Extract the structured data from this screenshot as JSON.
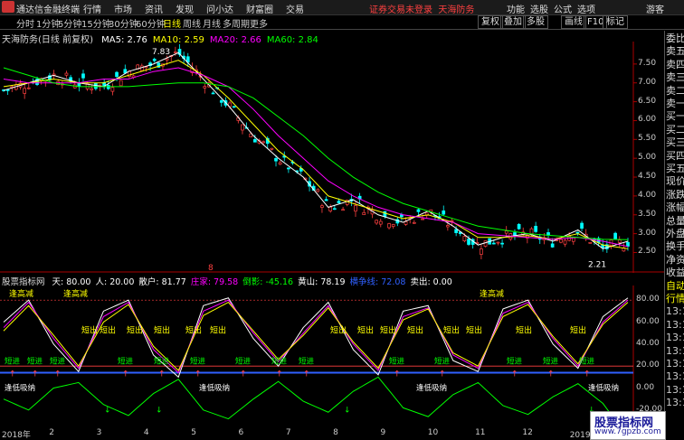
{
  "app": {
    "name": "通达信金融终端",
    "menu": [
      "行情",
      "市场",
      "资讯",
      "发现",
      "问小达",
      "财富圈",
      "交易"
    ],
    "ad_text": "证券交易未登录",
    "ad_link": "天海防务",
    "right_menu": [
      "功能",
      "选股",
      "公式",
      "选项"
    ],
    "user": "游客"
  },
  "toolbar": {
    "periods": [
      "分时",
      "1分钟",
      "5分钟",
      "15分钟",
      "30分钟",
      "60分钟",
      "日线",
      "周线",
      "月线",
      "多周期",
      "更多"
    ],
    "active_period": "日线",
    "right_buttons": [
      "复权",
      "叠加",
      "多股",
      "画线",
      "F10",
      "标记"
    ]
  },
  "chart_header": {
    "stock": "天海防务",
    "period_note": "(日线 前复权)",
    "ma": [
      {
        "label": "MA5:",
        "value": "2.76",
        "color": "#ffffff"
      },
      {
        "label": "MA10:",
        "value": "2.59",
        "color": "#ffff00"
      },
      {
        "label": "MA20:",
        "value": "2.66",
        "color": "#ff00ff"
      },
      {
        "label": "MA60:",
        "value": "2.84",
        "color": "#00ff00"
      }
    ]
  },
  "indicator_header": {
    "name": "股票指标网",
    "fields": [
      {
        "label": "天:",
        "value": "80.00",
        "color": "#ffffff"
      },
      {
        "label": "人:",
        "value": "20.00",
        "color": "#ffffff"
      },
      {
        "label": "散户:",
        "value": "81.77",
        "color": "#ffffff"
      },
      {
        "label": "庄家:",
        "value": "79.58",
        "color": "#ff00ff"
      },
      {
        "label": "倒影:",
        "value": "-45.16",
        "color": "#00ff00"
      },
      {
        "label": "黄山:",
        "value": "78.19",
        "color": "#ffffff"
      },
      {
        "label": "横争线:",
        "value": "72.08",
        "color": "#3060ff"
      },
      {
        "label": "卖出:",
        "value": "0.00",
        "color": "#ffffff"
      }
    ]
  },
  "sidebar_items": [
    "委比",
    "卖五",
    "卖四",
    "卖三",
    "卖二",
    "卖一",
    "买一",
    "买二",
    "买三",
    "买四",
    "买五",
    "现价",
    "涨跌",
    "涨幅",
    "总量",
    "外盘",
    "换手",
    "净资",
    "收益",
    "自动",
    "行情",
    "13:1",
    "13:1",
    "13:1",
    "13:1",
    "13:1",
    "13:1",
    "13:1",
    "13:1"
  ],
  "price_axis": [
    "7.50",
    "7.00",
    "6.50",
    "6.00",
    "5.50",
    "5.00",
    "4.50",
    "4.00",
    "3.50",
    "3.00",
    "2.50"
  ],
  "ind_axis": [
    "80.00",
    "60.00",
    "40.00",
    "20.00",
    "0.00",
    "-20.00"
  ],
  "date_labels": [
    "2018年",
    "2",
    "3",
    "4",
    "5",
    "6",
    "7",
    "8",
    "9",
    "10",
    "11",
    "12",
    "2019年",
    "2"
  ],
  "price_annotations": {
    "high": "7.83",
    "low": "2.21",
    "marker": "8"
  },
  "signal_texts": {
    "top": "逢高减",
    "sell": "短出",
    "buy": "短进",
    "low": "逢低吸纳"
  },
  "chart_data": [
    {
      "type": "line",
      "title": "天海防务 日线",
      "x_range": [
        1,
        14
      ],
      "ylim": [
        2.2,
        8.0
      ],
      "series": [
        {
          "name": "MA5",
          "color": "#ffffff",
          "values": [
            6.8,
            7.0,
            7.2,
            7.0,
            6.9,
            7.3,
            7.5,
            7.8,
            7.1,
            6.4,
            5.6,
            5.0,
            4.5,
            3.7,
            3.9,
            3.5,
            3.3,
            3.6,
            3.2,
            2.7,
            2.9,
            3.0,
            2.8,
            3.1,
            2.6,
            2.8
          ]
        },
        {
          "name": "MA10",
          "color": "#ffff00",
          "values": [
            6.9,
            7.0,
            7.1,
            7.0,
            7.0,
            7.2,
            7.4,
            7.6,
            7.2,
            6.6,
            5.9,
            5.2,
            4.7,
            4.0,
            3.8,
            3.6,
            3.4,
            3.5,
            3.3,
            2.9,
            2.9,
            2.95,
            2.85,
            3.0,
            2.7,
            2.6
          ]
        },
        {
          "name": "MA20",
          "color": "#ff00ff",
          "values": [
            7.1,
            7.0,
            7.0,
            7.0,
            7.1,
            7.1,
            7.3,
            7.4,
            7.2,
            6.9,
            6.3,
            5.6,
            5.0,
            4.4,
            4.0,
            3.7,
            3.5,
            3.4,
            3.3,
            3.0,
            2.95,
            2.9,
            2.85,
            2.9,
            2.8,
            2.66
          ]
        },
        {
          "name": "MA60",
          "color": "#00ff00",
          "values": [
            7.4,
            7.2,
            7.0,
            6.9,
            6.9,
            6.9,
            6.95,
            7.0,
            7.0,
            6.9,
            6.6,
            6.1,
            5.6,
            5.0,
            4.5,
            4.1,
            3.8,
            3.6,
            3.4,
            3.2,
            3.1,
            3.0,
            2.95,
            2.9,
            2.85,
            2.84
          ]
        }
      ]
    },
    {
      "type": "line",
      "title": "股票指标网",
      "ylim": [
        -30,
        90
      ],
      "series": [
        {
          "name": "散户",
          "color": "#ffffff",
          "values": [
            60,
            80,
            40,
            15,
            70,
            80,
            30,
            10,
            75,
            82,
            45,
            20,
            55,
            78,
            35,
            12,
            70,
            75,
            25,
            15,
            72,
            80,
            40,
            18,
            65,
            82
          ]
        },
        {
          "name": "庄家",
          "color": "#ff00ff",
          "values": [
            55,
            78,
            45,
            18,
            65,
            78,
            35,
            14,
            70,
            80,
            50,
            24,
            50,
            75,
            40,
            16,
            65,
            73,
            30,
            18,
            68,
            78,
            45,
            20,
            60,
            80
          ]
        },
        {
          "name": "黄山",
          "color": "#ffff00",
          "values": [
            52,
            75,
            48,
            20,
            60,
            76,
            38,
            16,
            66,
            78,
            52,
            26,
            48,
            73,
            42,
            18,
            62,
            72,
            32,
            20,
            65,
            76,
            47,
            22,
            58,
            78
          ]
        },
        {
          "name": "倒影",
          "color": "#00ff00",
          "values": [
            -10,
            -20,
            0,
            5,
            -15,
            -25,
            -5,
            8,
            -20,
            -28,
            -10,
            6,
            -12,
            -22,
            -3,
            10,
            -18,
            -26,
            -6,
            5,
            -16,
            -24,
            -8,
            4,
            -14,
            -45
          ]
        }
      ]
    }
  ]
}
